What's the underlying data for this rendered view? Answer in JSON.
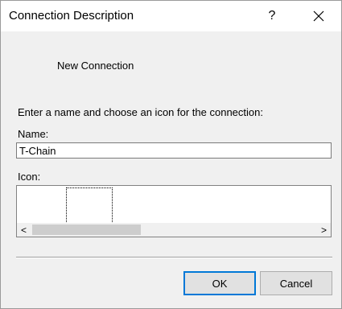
{
  "window": {
    "title": "Connection Description",
    "help_glyph": "?",
    "close_icon": "close-icon"
  },
  "header": {
    "title": "New Connection"
  },
  "form": {
    "prompt": "Enter a name and choose an icon for the connection:",
    "name_label": "Name:",
    "name_value": "T-Chain",
    "icon_label": "Icon:"
  },
  "scrollbar": {
    "left_glyph": "<",
    "right_glyph": ">"
  },
  "buttons": {
    "ok": "OK",
    "cancel": "Cancel"
  },
  "colors": {
    "accent": "#0078d7",
    "dialog_bg": "#f0f0f0",
    "button_bg": "#e1e1e1"
  }
}
